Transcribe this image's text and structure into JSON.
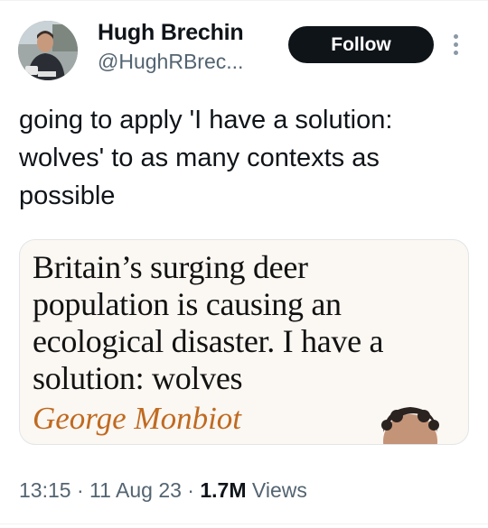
{
  "author": {
    "name": "Hugh Brechin",
    "handle": "@HughRBrec..."
  },
  "follow_label": "Follow",
  "tweet_text": "going to apply 'I have a solution: wolves' to as many contexts as possible",
  "card": {
    "headline": "Britain’s surging deer population is causing an ecological disaster. I have a solution: wolves",
    "author": "George Monbiot",
    "author_color": "#c06a21"
  },
  "meta": {
    "time": "13:15",
    "separator": " · ",
    "date": "11 Aug 23",
    "views_count": "1.7M",
    "views_label": "Views"
  },
  "icons": {
    "more": "more-vertical-icon"
  }
}
